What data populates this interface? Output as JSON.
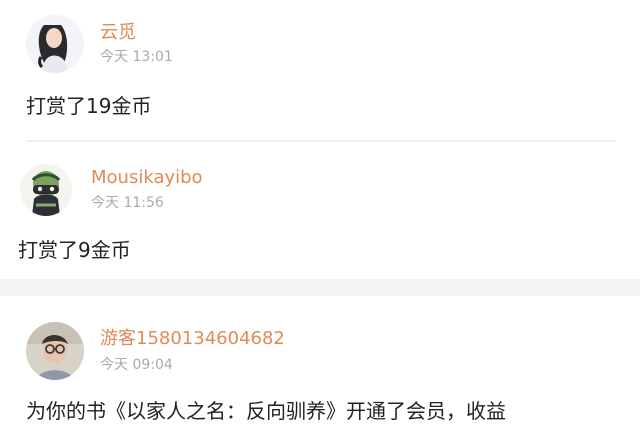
{
  "comments": [
    {
      "username": "云觅",
      "timestamp": "今天 13:01",
      "message": "打赏了19金币"
    },
    {
      "username": "Mousikayibo",
      "timestamp": "今天 11:56",
      "message": "打赏了9金币"
    },
    {
      "username": "游客1580134604682",
      "timestamp": "今天 09:04",
      "message": "为你的书《以家人之名：反向驯养》开通了会员，收益"
    }
  ],
  "colors": {
    "username": "#e28a57",
    "timestamp": "#aaaaaa",
    "message": "#222222",
    "divider": "#eeeeee",
    "section_gap": "#f3f3f3"
  },
  "icons": {
    "comment_1_avatar": "girl-portrait-avatar",
    "comment_2_avatar": "masked-character-avatar",
    "comment_3_avatar": "glasses-man-avatar"
  }
}
